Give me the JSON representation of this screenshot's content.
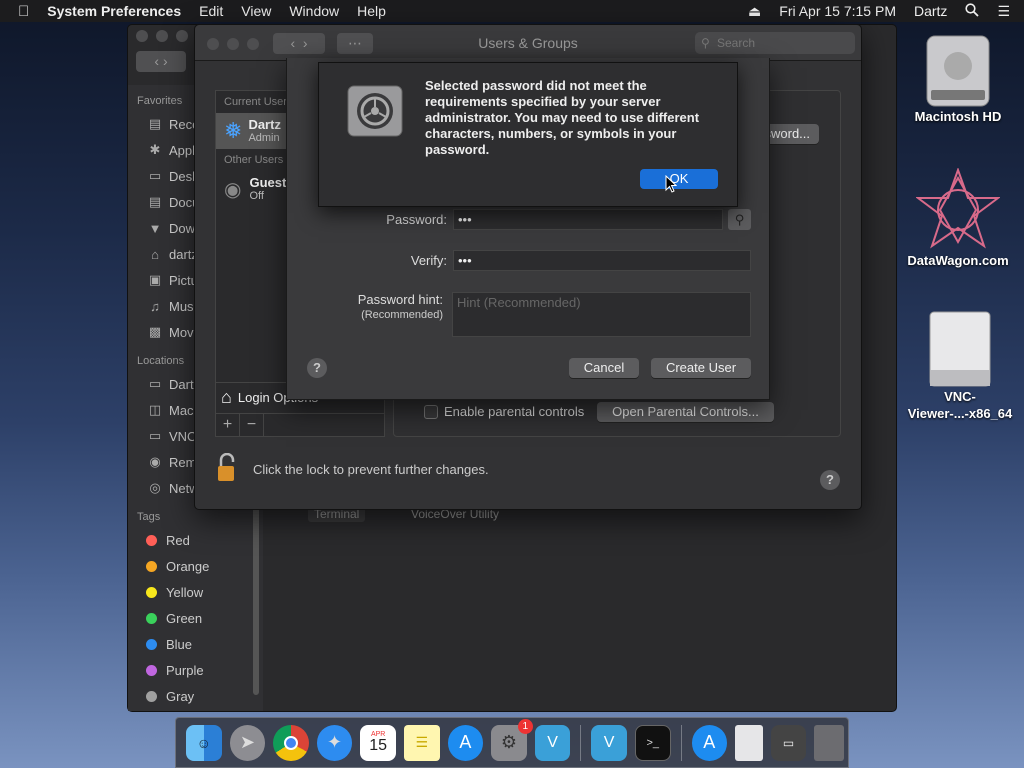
{
  "menubar": {
    "app": "System Preferences",
    "menus": [
      "Edit",
      "View",
      "Window",
      "Help"
    ],
    "datetime": "Fri Apr 15  7:15 PM",
    "user": "Dartz"
  },
  "finder": {
    "favorites_title": "Favorites",
    "favorites": [
      "Rece",
      "Appl",
      "Desk",
      "Docu",
      "Dow",
      "dartz",
      "Pictu",
      "Musi",
      "Movi"
    ],
    "locations_title": "Locations",
    "locations": [
      "Dartz",
      "Maci",
      "VNC",
      "Rem",
      "Netw"
    ],
    "tags_title": "Tags",
    "tags": [
      {
        "label": "Red",
        "color": "#ff5f57"
      },
      {
        "label": "Orange",
        "color": "#f5a623"
      },
      {
        "label": "Yellow",
        "color": "#f8e71c"
      },
      {
        "label": "Green",
        "color": "#3ad15b"
      },
      {
        "label": "Blue",
        "color": "#2d8cf0"
      },
      {
        "label": "Purple",
        "color": "#c066e0"
      },
      {
        "label": "Gray",
        "color": "#a0a0a0"
      }
    ],
    "bg_items": [
      "Terminal",
      "VoiceOver Utility"
    ]
  },
  "users_window": {
    "title": "Users & Groups",
    "search_placeholder": "Search",
    "current_users_label": "Current Users",
    "current_user": {
      "name": "Dartz",
      "role": "Admin"
    },
    "other_users_label": "Other Users",
    "guest": {
      "name": "Guest User",
      "status": "Off"
    },
    "login_options": "Login Options",
    "change_password_btn": "Change Password...",
    "parental_checkbox": "Enable parental controls",
    "parental_button": "Open Parental Controls...",
    "lock_text": "Click the lock to prevent further changes.",
    "help": "?"
  },
  "new_user_sheet": {
    "password_label": "Password:",
    "password_value": "•••",
    "verify_label": "Verify:",
    "verify_value": "•••",
    "hint_label": "Password hint:",
    "hint_sub": "(Recommended)",
    "hint_placeholder": "Hint (Recommended)",
    "cancel": "Cancel",
    "create": "Create User",
    "help": "?"
  },
  "alert": {
    "message": "Selected password did not meet the requirements specified by your server administrator. You may need to use different characters, numbers, or symbols in your password.",
    "ok": "OK"
  },
  "desktop": {
    "icons": [
      "Macintosh HD",
      "DataWagon.com",
      "VNC-\nViewer-...-x86_64"
    ]
  },
  "dock": {
    "apps": [
      "Finder",
      "Launchpad",
      "Chrome",
      "Safari",
      "Calendar",
      "Notes",
      "App Store",
      "System Preferences",
      "VNC Viewer",
      "VNC Viewer",
      "Terminal",
      "App Store",
      "Document",
      "Screen Sharing",
      "Trash"
    ],
    "calendar_month": "APR",
    "calendar_day": "15",
    "sysprefs_badge": "1"
  }
}
